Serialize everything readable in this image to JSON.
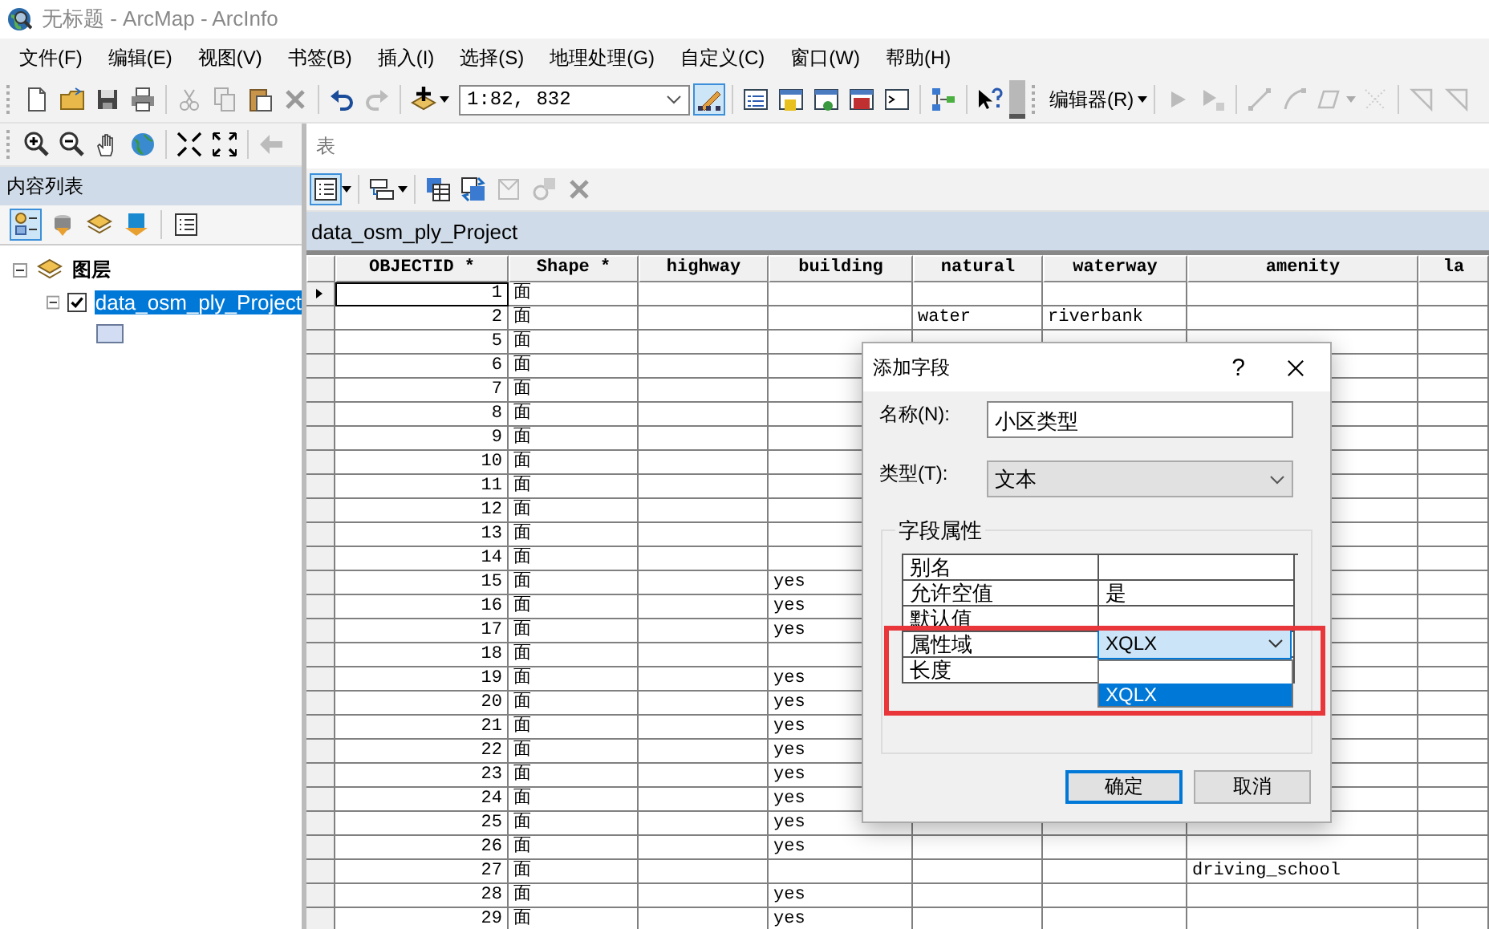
{
  "window": {
    "title": "无标题 - ArcMap - ArcInfo"
  },
  "menu": [
    "文件(F)",
    "编辑(E)",
    "视图(V)",
    "书签(B)",
    "插入(I)",
    "选择(S)",
    "地理处理(G)",
    "自定义(C)",
    "窗口(W)",
    "帮助(H)"
  ],
  "toolbar": {
    "scale": "1:82, 832",
    "editor": "编辑器(R)"
  },
  "toc": {
    "title": "内容列表",
    "group": {
      "label": "图层",
      "expanded": true,
      "children": [
        {
          "label": "data_osm_ply_Project",
          "checked": true,
          "selected": true,
          "expanded": true
        }
      ]
    }
  },
  "table_window": {
    "title": "表",
    "table_name": "data_osm_ply_Project",
    "columns": [
      "OBJECTID *",
      "Shape *",
      "highway",
      "building",
      "natural",
      "waterway",
      "amenity",
      "la"
    ],
    "rows": [
      {
        "current": true,
        "objectid": "1",
        "shape": "面"
      },
      {
        "current": false,
        "objectid": "2",
        "shape": "面",
        "natural": "water",
        "waterway": "riverbank"
      },
      {
        "current": false,
        "objectid": "5",
        "shape": "面"
      },
      {
        "current": false,
        "objectid": "6",
        "shape": "面"
      },
      {
        "current": false,
        "objectid": "7",
        "shape": "面"
      },
      {
        "current": false,
        "objectid": "8",
        "shape": "面"
      },
      {
        "current": false,
        "objectid": "9",
        "shape": "面"
      },
      {
        "current": false,
        "objectid": "10",
        "shape": "面"
      },
      {
        "current": false,
        "objectid": "11",
        "shape": "面"
      },
      {
        "current": false,
        "objectid": "12",
        "shape": "面"
      },
      {
        "current": false,
        "objectid": "13",
        "shape": "面"
      },
      {
        "current": false,
        "objectid": "14",
        "shape": "面"
      },
      {
        "current": false,
        "objectid": "15",
        "shape": "面",
        "building": "yes"
      },
      {
        "current": false,
        "objectid": "16",
        "shape": "面",
        "building": "yes"
      },
      {
        "current": false,
        "objectid": "17",
        "shape": "面",
        "building": "yes"
      },
      {
        "current": false,
        "objectid": "18",
        "shape": "面"
      },
      {
        "current": false,
        "objectid": "19",
        "shape": "面",
        "building": "yes"
      },
      {
        "current": false,
        "objectid": "20",
        "shape": "面",
        "building": "yes"
      },
      {
        "current": false,
        "objectid": "21",
        "shape": "面",
        "building": "yes"
      },
      {
        "current": false,
        "objectid": "22",
        "shape": "面",
        "building": "yes"
      },
      {
        "current": false,
        "objectid": "23",
        "shape": "面",
        "building": "yes"
      },
      {
        "current": false,
        "objectid": "24",
        "shape": "面",
        "building": "yes"
      },
      {
        "current": false,
        "objectid": "25",
        "shape": "面",
        "building": "yes"
      },
      {
        "current": false,
        "objectid": "26",
        "shape": "面",
        "building": "yes"
      },
      {
        "current": false,
        "objectid": "27",
        "shape": "面",
        "amenity": "driving_school"
      },
      {
        "current": false,
        "objectid": "28",
        "shape": "面",
        "building": "yes"
      },
      {
        "current": false,
        "objectid": "29",
        "shape": "面",
        "building": "yes"
      }
    ]
  },
  "dialog": {
    "title": "添加字段",
    "help": "?",
    "name_label": "名称(N):",
    "name_value": "小区类型",
    "type_label": "类型(T):",
    "type_value": "文本",
    "group_label": "字段属性",
    "properties": [
      {
        "kind": "text",
        "label": "别名"
      },
      {
        "kind": "text",
        "label": "允许空值",
        "value": "是"
      },
      {
        "kind": "text",
        "label": "默认值"
      },
      {
        "kind": "dropdown",
        "label": "属性域",
        "value": "XQLX",
        "open": true,
        "options": [
          {
            "label": "XQLX",
            "selected": true
          }
        ]
      },
      {
        "kind": "text",
        "label": "长度"
      }
    ],
    "buttons": [
      {
        "label": "确定",
        "default": true
      },
      {
        "label": "取消",
        "default": false
      }
    ],
    "highlight": true
  }
}
